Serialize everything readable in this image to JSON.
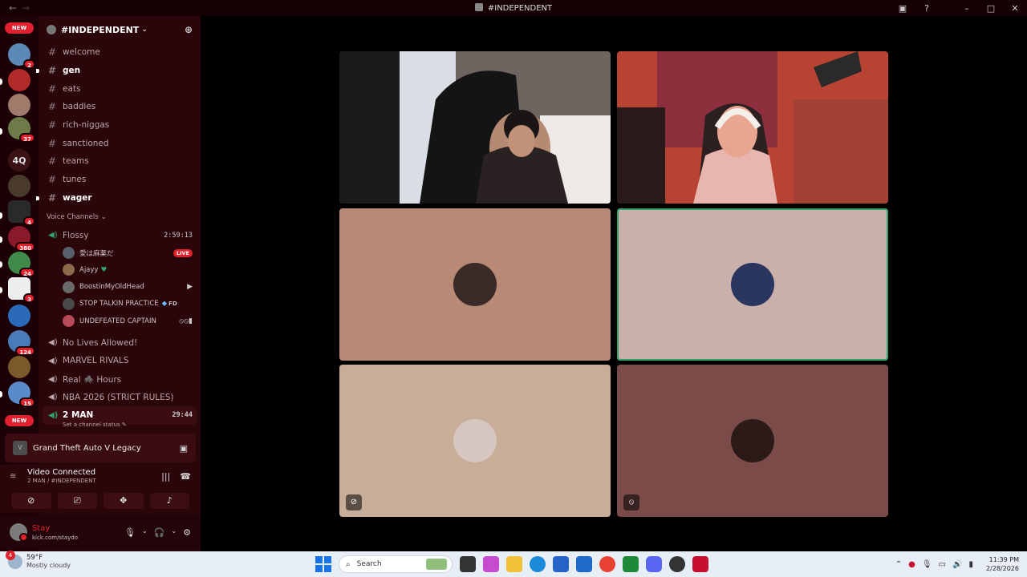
{
  "window": {
    "title": "#INDEPENDENT",
    "back_icon": "arrow-left",
    "forward_icon": "arrow-right"
  },
  "rail": {
    "new_top": "NEW",
    "new_bottom": "NEW",
    "server_text": "4Q",
    "badges": [
      "2",
      "37",
      "4",
      "380",
      "24",
      "3",
      "124",
      "15"
    ]
  },
  "server": {
    "name": "#INDEPENDENT",
    "text_channels": [
      {
        "name": "welcome",
        "unread": false
      },
      {
        "name": "gen",
        "unread": true
      },
      {
        "name": "eats",
        "unread": false
      },
      {
        "name": "baddies",
        "unread": false
      },
      {
        "name": "rich-niggas",
        "unread": false
      },
      {
        "name": "sanctioned",
        "unread": false
      },
      {
        "name": "teams",
        "unread": false
      },
      {
        "name": "tunes",
        "unread": false
      },
      {
        "name": "wager",
        "unread": true
      }
    ],
    "voice_category": "Voice Channels",
    "voice_channels": {
      "flossy": {
        "name": "Flossy",
        "timer": "2:59:13"
      },
      "flossy_users": [
        {
          "name": "愛は麻薬だ",
          "tag": "LIVE"
        },
        {
          "name": "Ajayy",
          "tag": ""
        },
        {
          "name": "BoostinMyOldHead",
          "tag": ""
        },
        {
          "name": "STOP TALKIN PRACTICE",
          "tag": "FD"
        },
        {
          "name": "UNDEFEATED CAPTAIN",
          "tag": ""
        }
      ],
      "others": [
        "No Lives Allowed!",
        "MARVEL RIVALS",
        "Real 🕷️ Hours",
        "NBA 2026 (STRICT RULES)"
      ],
      "two_man": {
        "name": "2 MAN",
        "timer": "29:44",
        "status": "Set a channel status"
      }
    }
  },
  "activity": {
    "game": "Grand Theft Auto V Legacy"
  },
  "voice_connection": {
    "status": "Video Connected",
    "location": "2 MAN / #INDEPENDENT"
  },
  "user": {
    "name": "Stay",
    "status": "kick.com/staydo"
  },
  "video_tiles": [
    {
      "kind": "camera",
      "bg": "#5a4a48",
      "speaking": false
    },
    {
      "kind": "camera",
      "bg": "#a5392c",
      "speaking": false
    },
    {
      "kind": "avatar",
      "bg": "#b88a76",
      "avatar_color": "#3b2b28",
      "speaking": false,
      "muted_icon": ""
    },
    {
      "kind": "avatar",
      "bg": "#c9b0aa",
      "avatar_color": "#2a3560",
      "speaking": true,
      "muted_icon": ""
    },
    {
      "kind": "avatar",
      "bg": "#c8ad99",
      "avatar_color": "#d5c6c0",
      "speaking": false,
      "muted_icon": "deafened-icon"
    },
    {
      "kind": "avatar",
      "bg": "#7a4b49",
      "avatar_color": "#2b1a17",
      "speaking": false,
      "muted_icon": "mic-muted-icon"
    }
  ],
  "taskbar": {
    "weather_temp": "59°F",
    "weather_desc": "Mostly cloudy",
    "weather_badge": "4",
    "search_placeholder": "Search",
    "time": "11:39 PM",
    "date": "2/28/2026"
  },
  "colors": {
    "accent_red": "#e1212b",
    "speaking_green": "#2ea56b",
    "sidebar_bg": "#2a0509"
  }
}
